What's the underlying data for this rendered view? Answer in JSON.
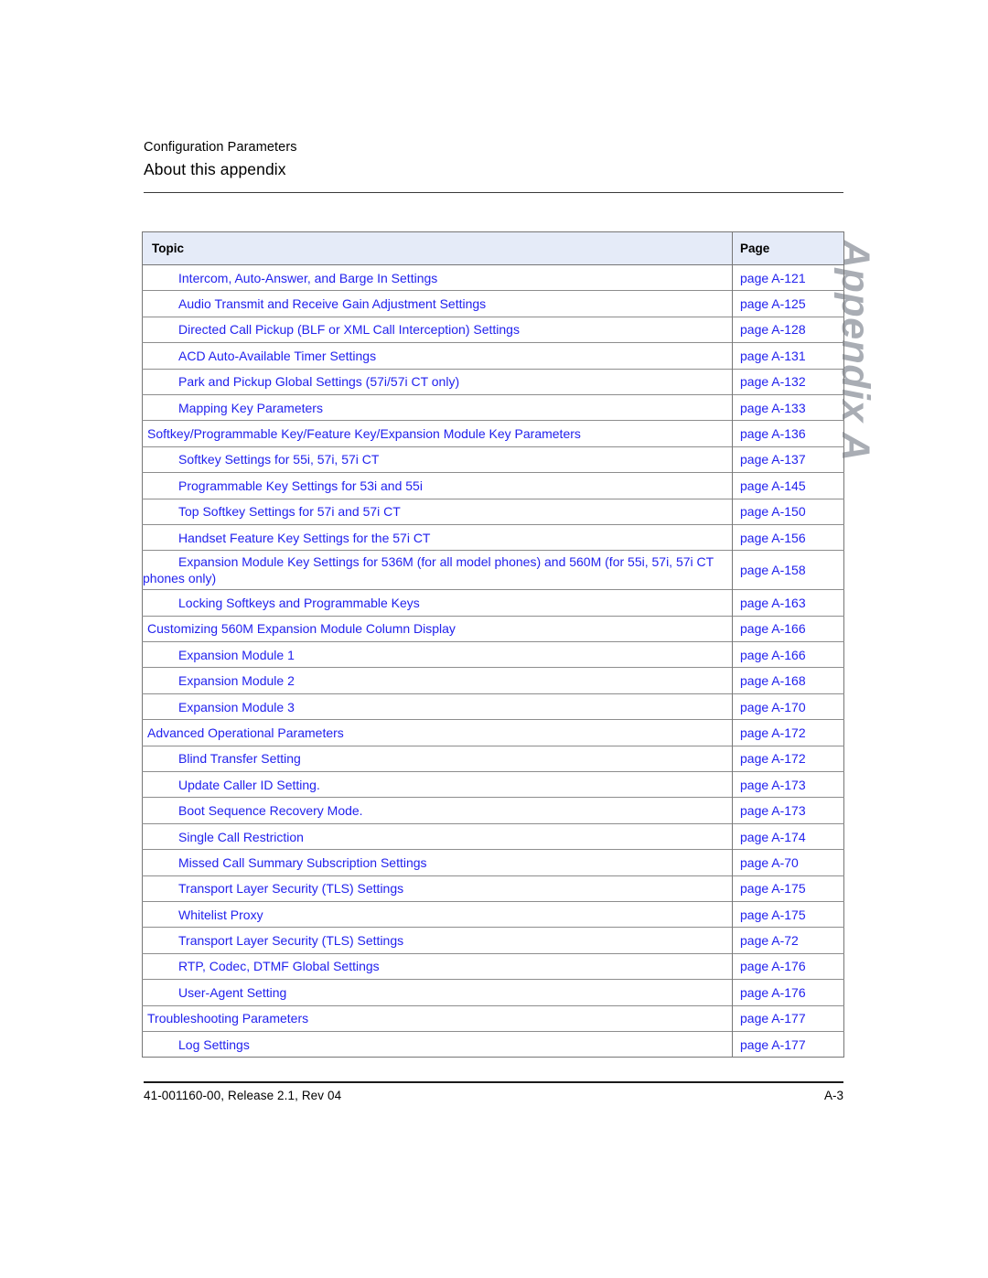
{
  "header": {
    "chapter": "Configuration Parameters",
    "title": "About this appendix"
  },
  "side_tab": {
    "label": "Appendix A"
  },
  "table": {
    "columns": {
      "topic": "Topic",
      "page": "Page"
    },
    "rows": [
      {
        "level": 1,
        "topic": "Intercom, Auto-Answer, and Barge In Settings",
        "page": "page A-121"
      },
      {
        "level": 1,
        "topic": "Audio Transmit and Receive Gain Adjustment Settings",
        "page": "page A-125"
      },
      {
        "level": 1,
        "topic": "Directed Call Pickup (BLF or XML Call Interception) Settings",
        "page": "page A-128"
      },
      {
        "level": 1,
        "topic": "ACD Auto-Available Timer Settings",
        "page": "page A-131"
      },
      {
        "level": 1,
        "topic": "Park and Pickup Global Settings (57i/57i CT only)",
        "page": "page A-132"
      },
      {
        "level": 1,
        "topic": "Mapping Key Parameters",
        "page": "page A-133"
      },
      {
        "level": 0,
        "topic": "Softkey/Programmable Key/Feature Key/Expansion Module Key Parameters",
        "page": "page A-136"
      },
      {
        "level": 1,
        "topic": "Softkey Settings for 55i, 57i, 57i CT",
        "page": "page A-137"
      },
      {
        "level": 1,
        "topic": "Programmable Key Settings for 53i and 55i",
        "page": "page A-145"
      },
      {
        "level": 1,
        "topic": "Top Softkey Settings for 57i and 57i CT",
        "page": "page A-150"
      },
      {
        "level": 1,
        "topic": "Handset Feature Key Settings for the 57i CT",
        "page": "page A-156"
      },
      {
        "level": 1,
        "topic": "Expansion Module Key Settings for 536M (for all model phones) and 560M (for 55i, 57i, 57i CT phones only)",
        "page": "page A-158"
      },
      {
        "level": 1,
        "topic": "Locking Softkeys and Programmable Keys",
        "page": "page A-163"
      },
      {
        "level": 0,
        "topic": "Customizing 560M Expansion Module Column Display",
        "page": "page A-166"
      },
      {
        "level": 1,
        "topic": "Expansion Module 1",
        "page": "page A-166"
      },
      {
        "level": 1,
        "topic": "Expansion Module 2",
        "page": "page A-168"
      },
      {
        "level": 1,
        "topic": "Expansion Module 3",
        "page": "page A-170"
      },
      {
        "level": 0,
        "topic": "Advanced Operational Parameters",
        "page": "page A-172"
      },
      {
        "level": 1,
        "topic": "Blind Transfer Setting",
        "page": "page A-172"
      },
      {
        "level": 1,
        "topic": "Update Caller ID Setting.",
        "page": "page A-173"
      },
      {
        "level": 1,
        "topic": "Boot Sequence Recovery Mode.",
        "page": "page A-173"
      },
      {
        "level": 1,
        "topic": "Single Call Restriction",
        "page": "page A-174"
      },
      {
        "level": 1,
        "topic": "Missed Call Summary Subscription Settings",
        "page": "page A-70"
      },
      {
        "level": 1,
        "topic": "Transport Layer Security (TLS) Settings",
        "page": "page A-175"
      },
      {
        "level": 1,
        "topic": "Whitelist Proxy",
        "page": "page A-175"
      },
      {
        "level": 1,
        "topic": "Transport Layer Security (TLS) Settings",
        "page": "page A-72"
      },
      {
        "level": 1,
        "topic": "RTP, Codec, DTMF Global Settings",
        "page": "page A-176"
      },
      {
        "level": 1,
        "topic": "User-Agent Setting",
        "page": "page A-176"
      },
      {
        "level": 0,
        "topic": "Troubleshooting Parameters",
        "page": "page A-177"
      },
      {
        "level": 1,
        "topic": "Log Settings",
        "page": "page A-177"
      }
    ]
  },
  "footer": {
    "left": "41-001160-00, Release 2.1, Rev 04",
    "right": "A-3"
  },
  "colors": {
    "link": "#2222ee",
    "table_header_bg": "#e5ebf8",
    "side_tab": "#a9adb4",
    "border": "#767676"
  }
}
